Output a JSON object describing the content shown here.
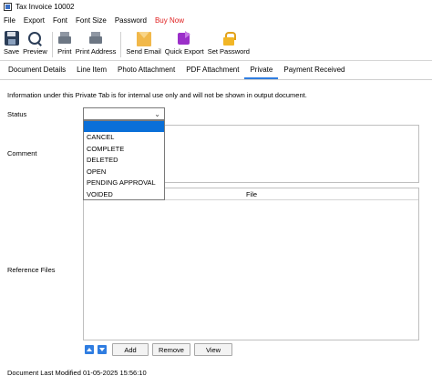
{
  "window": {
    "title": "Tax Invoice 10002"
  },
  "menu": [
    "File",
    "Export",
    "Font",
    "Font Size",
    "Password",
    "Buy Now"
  ],
  "toolbar": {
    "save": "Save",
    "preview": "Preview",
    "print": "Print",
    "print_address": "Print Address",
    "send_email": "Send Email",
    "quick_export": "Quick Export",
    "set_password": "Set Password"
  },
  "tabs": [
    "Document Details",
    "Line Item",
    "Photo Attachment",
    "PDF Attachment",
    "Private",
    "Payment Received"
  ],
  "active_tab": "Private",
  "private": {
    "info": "Information under this Private Tab is for internal use only and will not be shown in output document.",
    "status_label": "Status",
    "status_value": "",
    "status_options": [
      "",
      "CANCEL",
      "COMPLETE",
      "DELETED",
      "OPEN",
      "PENDING APPROVAL",
      "VOIDED"
    ],
    "comment_label": "Comment",
    "reference_label": "Reference Files",
    "file_column": "File",
    "add_button": "Add",
    "remove_button": "Remove",
    "view_button": "View",
    "last_modified_label": "Document Last Modified",
    "last_modified_value": "01-05-2025 15:56:10"
  },
  "colors": {
    "accent": "#2f7de1",
    "selected": "#0a6fd8",
    "buy_now": "#e02020"
  }
}
